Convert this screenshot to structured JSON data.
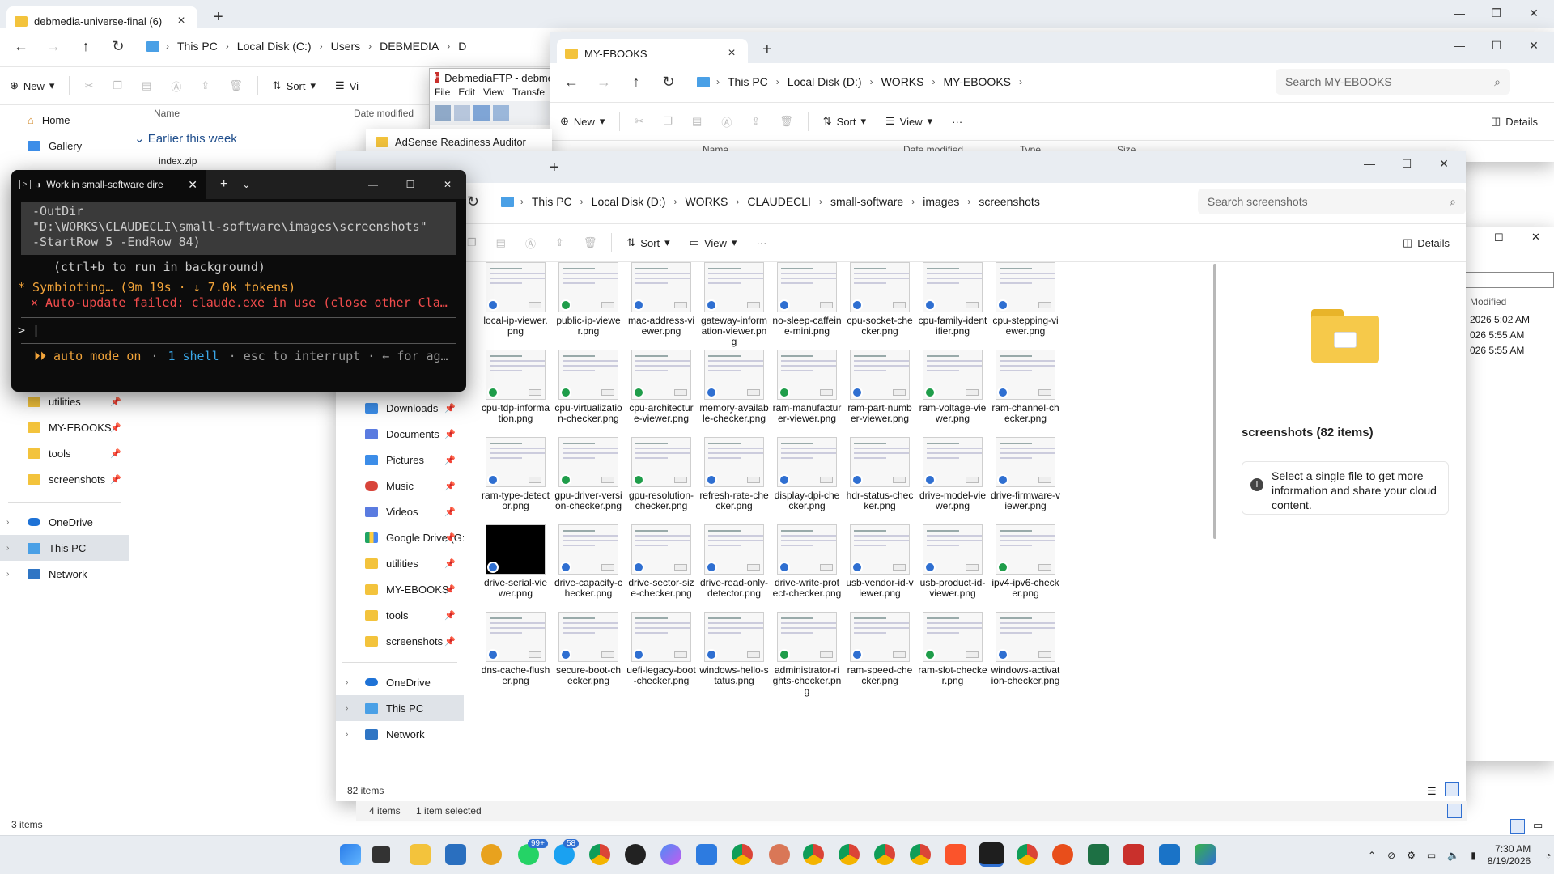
{
  "colors": {
    "accent": "#2f6fd1",
    "terminal_bg": "#0c0c0c",
    "error": "#f14c4c",
    "warn": "#f2a43a",
    "cyan": "#3aa7e8"
  },
  "back_window": {
    "tab_title": "debmedia-universe-final (6)",
    "crumbs": [
      "This PC",
      "Local Disk (C:)",
      "Users",
      "DEBMEDIA",
      "D"
    ],
    "new_label": "New",
    "sort_label": "Sort",
    "view_label": "Vi",
    "home": "Home",
    "gallery": "Gallery",
    "col_name": "Name",
    "col_date": "Date modified",
    "group": "Earlier this week",
    "file_partial": "index.zip",
    "quick": [
      {
        "label": "utilities",
        "icon": "folder-icon"
      },
      {
        "label": "MY-EBOOKS",
        "icon": "folder-icon"
      },
      {
        "label": "tools",
        "icon": "folder-icon"
      },
      {
        "label": "screenshots",
        "icon": "folder-icon"
      }
    ],
    "roots": [
      "OneDrive",
      "This PC",
      "Network"
    ],
    "status": "3 items"
  },
  "ftp_window": {
    "title": "DebmediaFTP - debme",
    "menu": [
      "File",
      "Edit",
      "View",
      "Transfe"
    ]
  },
  "ebooks_window": {
    "tab_title": "MY-EBOOKS",
    "crumbs": [
      "This PC",
      "Local Disk (D:)",
      "WORKS",
      "MY-EBOOKS"
    ],
    "search_placeholder": "Search MY-EBOOKS",
    "new_label": "New",
    "sort_label": "Sort",
    "view_label": "View",
    "details_label": "Details",
    "cols": [
      "Name",
      "Date modified",
      "Type",
      "Size"
    ]
  },
  "auditor_tab": "AdSense Readiness Auditor",
  "right_window": {
    "col": "Modified",
    "dates": [
      "2026 5:02 AM",
      "026 5:55 AM",
      "026 5:55 AM"
    ]
  },
  "screens_window": {
    "crumbs": [
      "This PC",
      "Local Disk (D:)",
      "WORKS",
      "CLAUDECLI",
      "small-software",
      "images",
      "screenshots"
    ],
    "search_placeholder": "Search screenshots",
    "sort_label": "Sort",
    "view_label": "View",
    "details_label": "Details",
    "nav": [
      {
        "label": "Downloads",
        "icon": "downloads-icon"
      },
      {
        "label": "Documents",
        "icon": "documents-icon"
      },
      {
        "label": "Pictures",
        "icon": "pictures-icon"
      },
      {
        "label": "Music",
        "icon": "music-icon"
      },
      {
        "label": "Videos",
        "icon": "videos-icon"
      },
      {
        "label": "Google Drive (G:",
        "icon": "google-drive-icon"
      },
      {
        "label": "utilities",
        "icon": "folder-icon"
      },
      {
        "label": "MY-EBOOKS",
        "icon": "folder-icon"
      },
      {
        "label": "tools",
        "icon": "folder-icon"
      },
      {
        "label": "screenshots",
        "icon": "folder-icon"
      }
    ],
    "roots": [
      "OneDrive",
      "This PC",
      "Network"
    ],
    "files": [
      "local-ip-viewer.png",
      "public-ip-viewer.png",
      "mac-address-viewer.png",
      "gateway-information-viewer.png",
      "no-sleep-caffeine-mini.png",
      "cpu-socket-checker.png",
      "cpu-family-identifier.png",
      "cpu-stepping-viewer.png",
      "cpu-tdp-information.png",
      "cpu-virtualization-checker.png",
      "cpu-architecture-viewer.png",
      "memory-available-checker.png",
      "ram-manufacturer-viewer.png",
      "ram-part-number-viewer.png",
      "ram-voltage-viewer.png",
      "ram-channel-checker.png",
      "ram-type-detector.png",
      "gpu-driver-version-checker.png",
      "gpu-resolution-checker.png",
      "refresh-rate-checker.png",
      "display-dpi-checker.png",
      "hdr-status-checker.png",
      "drive-model-viewer.png",
      "drive-firmware-viewer.png",
      "drive-serial-viewer.png",
      "drive-capacity-checker.png",
      "drive-sector-size-checker.png",
      "drive-read-only-detector.png",
      "drive-write-protect-checker.png",
      "usb-vendor-id-viewer.png",
      "usb-product-id-viewer.png",
      "ipv4-ipv6-checker.png",
      "dns-cache-flusher.png",
      "secure-boot-checker.png",
      "uefi-legacy-boot-checker.png",
      "windows-hello-status.png",
      "administrator-rights-checker.png",
      "ram-speed-checker.png",
      "ram-slot-checker.png",
      "windows-activation-checker.png"
    ],
    "details_title": "screenshots (82 items)",
    "details_msg": "Select a single file to get more information and share your cloud content.",
    "status_count": "82 items",
    "under_status_items": "4 items",
    "under_status_sel": "1 item selected"
  },
  "terminal": {
    "tab_title": "Work in small-software dire",
    "lines": [
      "-OutDir",
      "\"D:\\WORKS\\CLAUDECLI\\small-software\\images\\screenshots\"",
      "-StartRow 5 -EndRow 84)"
    ],
    "hint": "(ctrl+b to run in background)",
    "spinner": "* Symbioting… (9m 19s · ↓ 7.0k tokens)",
    "error": "× Auto-update failed: claude.exe in use (close other Cla…",
    "prompt": "> |",
    "footer_mode": "⏵⏵ auto mode on",
    "footer_shell": "1 shell",
    "footer_rest": "· esc to interrupt · ← for ag…"
  },
  "taskbar": {
    "badge_whatsapp": "99+",
    "badge_messenger": "58",
    "time": "7:30 AM",
    "date": "8/19/2026"
  }
}
